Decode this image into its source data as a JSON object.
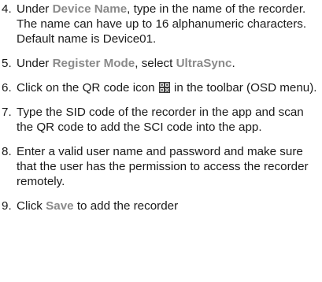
{
  "steps": [
    {
      "number": "4.",
      "parts": [
        "Under ",
        "Device Name",
        ", type in the name of the recorder. The name can have up to 16 alphanumeric characters. Default name is Device01."
      ]
    },
    {
      "number": "5.",
      "parts": [
        "Under ",
        "Register Mode",
        ", select ",
        "UltraSync",
        "."
      ]
    },
    {
      "number": "6.",
      "parts": [
        "Click on the QR code icon ",
        " in the toolbar (OSD menu)."
      ],
      "icon": "qr-code-icon"
    },
    {
      "number": "7.",
      "text": "Type the SID code of the recorder in the app and scan the QR code to add the SCI code into the app."
    },
    {
      "number": "8.",
      "text": "Enter a valid user name and password and make sure that the user has the permission to access the recorder remotely."
    },
    {
      "number": "9.",
      "parts": [
        "Click ",
        "Save",
        " to add the recorder"
      ]
    }
  ],
  "colors": {
    "text": "#1a1a1a",
    "highlight": "#8a8a8a"
  }
}
